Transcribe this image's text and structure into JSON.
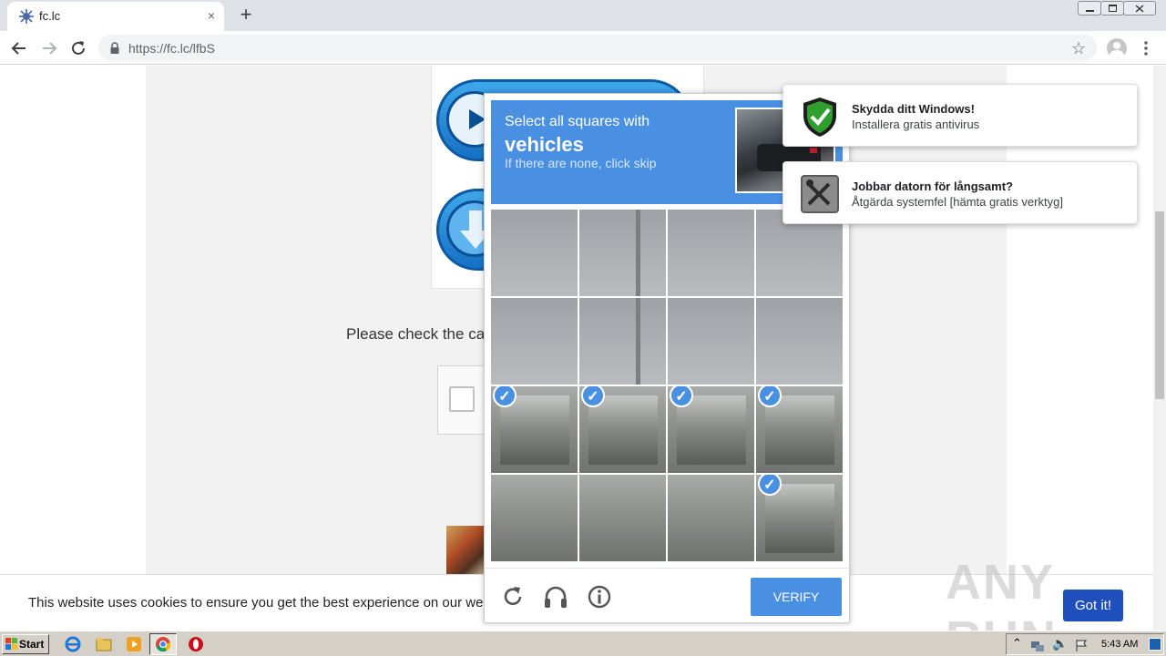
{
  "browser": {
    "tab_title": "fc.lc",
    "url": "https://fc.lc/lfbS",
    "new_tab_symbol": "+",
    "close_tab_symbol": "×"
  },
  "page": {
    "instruction": "Please check the ca",
    "cookie_text": "This website uses cookies to ensure you get the best experience on our we",
    "cookie_button": "Got it!",
    "watermark": "ANY RUN"
  },
  "captcha": {
    "line1": "Select all squares with",
    "line2": "vehicles",
    "line3": "If there are none, click skip",
    "verify_label": "VERIFY",
    "check_symbol": "✓",
    "tiles_selected": [
      false,
      false,
      false,
      false,
      false,
      false,
      false,
      false,
      true,
      true,
      true,
      true,
      false,
      false,
      false,
      true
    ]
  },
  "notifications": [
    {
      "title": "Skydda ditt Windows!",
      "body": "Installera gratis antivirus",
      "icon": "shield-check-icon"
    },
    {
      "title": "Jobbar datorn för långsamt?",
      "body": "Åtgärda systemfel [hämta gratis verktyg]",
      "icon": "tools-icon"
    }
  ],
  "taskbar": {
    "start_label": "Start",
    "clock": "5:43 AM"
  },
  "colors": {
    "captcha_blue": "#4a90e2",
    "cookie_button": "#1f4fbd",
    "shield_green": "#2e9e2e"
  }
}
